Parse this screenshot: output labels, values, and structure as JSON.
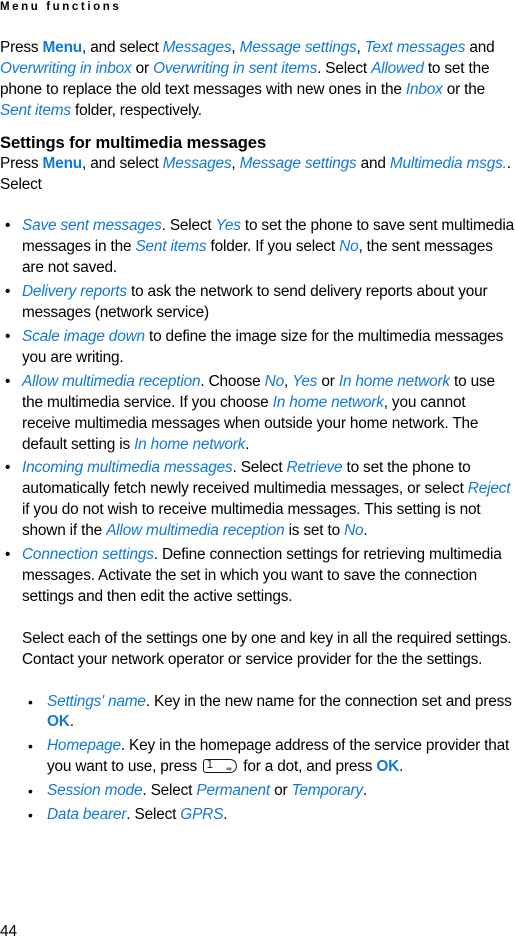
{
  "page": {
    "running_head": "Menu functions",
    "folio": "44",
    "accent_color": "#1179d6",
    "text_color": "#000000",
    "background_color": "#ffffff"
  },
  "intro_paragraph": {
    "s1": "Press ",
    "menu": "Menu",
    "s2": ", and select ",
    "messages": "Messages",
    "s3": ", ",
    "message_settings": "Message settings",
    "s4": ", ",
    "text_messages": "Text messages",
    "s5": " and ",
    "overwriting_inbox": "Overwriting in inbox",
    "s6": " or ",
    "overwriting_sent": "Overwriting in sent items",
    "s7": ". Select ",
    "allowed": "Allowed",
    "s8": " to set the phone to replace the old text messages with new ones in the ",
    "inbox": "Inbox",
    "s9": " or the ",
    "sent_items": "Sent items",
    "s10": " folder, respectively."
  },
  "section": {
    "heading": "Settings for multimedia messages",
    "lead": {
      "s1": "Press ",
      "menu": "Menu",
      "s2": ", and select ",
      "messages": "Messages",
      "s3": ", ",
      "message_settings": "Message settings",
      "s4": " and ",
      "multimedia_msgs": "Multimedia msgs.",
      "s5": ". Select"
    }
  },
  "bullets": [
    {
      "marker": "•",
      "title": "Save sent messages",
      "p1": ". Select ",
      "v1": "Yes",
      "p2": " to set the phone to save sent multimedia messages in the ",
      "v2": "Sent items",
      "p3": " folder. If you select ",
      "v3": "No",
      "p4": ", the sent messages are not saved."
    },
    {
      "marker": "•",
      "title": "Delivery reports",
      "p1": " to ask the network to send delivery reports about your messages (network service)"
    },
    {
      "marker": "•",
      "title": "Scale image down",
      "p1": " to define the image size for the multimedia messages you are writing."
    },
    {
      "marker": "•",
      "title": "Allow multimedia reception",
      "p1": ". Choose ",
      "v1": "No",
      "p2": ", ",
      "v2": "Yes",
      "p3": " or ",
      "v3": "In home network",
      "p4": " to use the multimedia service. If you choose ",
      "v4": "In home network",
      "p5": ", you cannot receive multimedia messages when outside your home network. The default setting is ",
      "v5": "In home network",
      "p6": "."
    },
    {
      "marker": "•",
      "title": "Incoming multimedia messages",
      "p1": ". Select ",
      "v1": "Retrieve",
      "p2": " to set the phone to automatically fetch newly received multimedia messages, or select ",
      "v2": "Reject",
      "p3": " if you do not wish to receive multimedia messages. This setting is not shown if the ",
      "v3": "Allow multimedia reception",
      "p4": " is set to ",
      "v4": "No",
      "p5": "."
    },
    {
      "marker": "•",
      "title": "Connection settings",
      "p1": ". Define connection settings for retrieving multimedia messages. Activate the set in which you want to save the connection settings and then edit the active settings."
    }
  ],
  "sub_paragraph": "Select each of the settings one by one and key in all the required settings. Contact your network operator or service provider for the the settings.",
  "nested_bullets": [
    {
      "marker": "•",
      "title": "Settings' name",
      "p1": ". Key in the new name for the connection set and press ",
      "ok": "OK",
      "p2": "."
    },
    {
      "marker": "•",
      "title": "Homepage",
      "p1": ". Key in the homepage address of the service provider that you want to use, press ",
      "keycap": {
        "number": "1",
        "mark": "∞",
        "name": "key-1-icon"
      },
      "p2": " for a dot, and press ",
      "ok": "OK",
      "p3": "."
    },
    {
      "marker": "•",
      "title": "Session mode",
      "p1": ". Select ",
      "v1": "Permanent",
      "p2": " or ",
      "v2": "Temporary",
      "p3": "."
    },
    {
      "marker": "•",
      "title": "Data bearer",
      "p1": ". Select ",
      "v1": "GPRS",
      "p2": "."
    }
  ]
}
